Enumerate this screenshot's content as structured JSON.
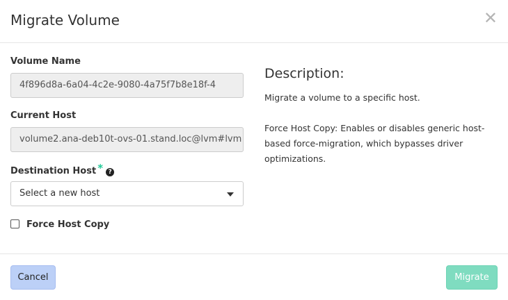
{
  "header": {
    "title": "Migrate Volume",
    "close_glyph": "✕"
  },
  "form": {
    "volume_name": {
      "label": "Volume Name",
      "value": "4f896d8a-6a04-4c2e-9080-4a75f7b8e18f-4"
    },
    "current_host": {
      "label": "Current Host",
      "value": "volume2.ana-deb10t-ovs-01.stand.loc@lvm#lvm"
    },
    "destination_host": {
      "label": "Destination Host",
      "required_mark": "*",
      "help_glyph": "?",
      "selected": "Select a new host"
    },
    "force_host_copy": {
      "label": "Force Host Copy",
      "checked": false
    }
  },
  "description": {
    "title": "Description:",
    "text1": "Migrate a volume to a specific host.",
    "text2": "Force Host Copy: Enables or disables generic host-based force-migration, which bypasses driver optimizations."
  },
  "footer": {
    "cancel_label": "Cancel",
    "migrate_label": "Migrate"
  },
  "colors": {
    "required": "#20c997",
    "cancel_bg": "#bcd0f7",
    "migrate_bg": "#7fdcc0"
  }
}
